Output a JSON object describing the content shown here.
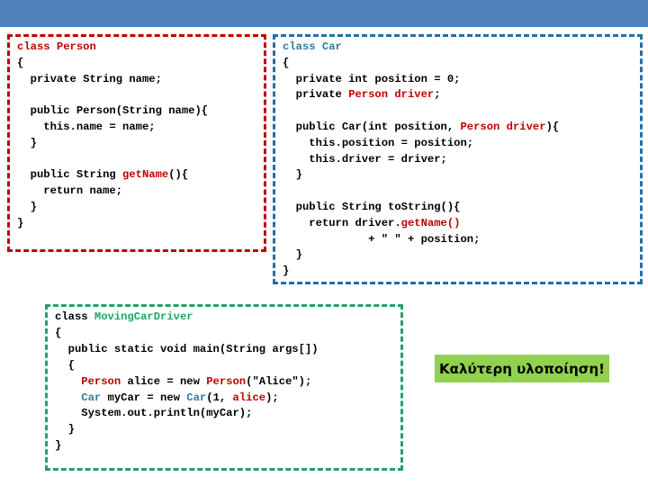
{
  "slide": {
    "top_bar_color": "#4f81bd",
    "background_color": "#ffffff"
  },
  "boxes": {
    "person": {
      "name": "Person class code block",
      "border_color": "#c00000",
      "lines": [
        [
          {
            "t": "class Person",
            "c": "red"
          }
        ],
        [
          {
            "t": "{",
            "c": "plain"
          }
        ],
        [
          {
            "t": "  private String name;",
            "c": "plain"
          }
        ],
        [
          {
            "t": "",
            "c": "plain"
          }
        ],
        [
          {
            "t": "  public Person(String name){",
            "c": "plain"
          }
        ],
        [
          {
            "t": "    this.name = name;",
            "c": "plain"
          }
        ],
        [
          {
            "t": "  }",
            "c": "plain"
          }
        ],
        [
          {
            "t": "",
            "c": "plain"
          }
        ],
        [
          {
            "t": "  public String ",
            "c": "plain"
          },
          {
            "t": "getName",
            "c": "red"
          },
          {
            "t": "(){",
            "c": "plain"
          }
        ],
        [
          {
            "t": "    return name;",
            "c": "plain"
          }
        ],
        [
          {
            "t": "  }",
            "c": "plain"
          }
        ],
        [
          {
            "t": "}",
            "c": "plain"
          }
        ]
      ]
    },
    "car": {
      "name": "Car class code block",
      "border_color": "#1f6fa8",
      "lines": [
        [
          {
            "t": "class Car",
            "c": "blue"
          }
        ],
        [
          {
            "t": "{",
            "c": "plain"
          }
        ],
        [
          {
            "t": "  private int position = 0;",
            "c": "plain"
          }
        ],
        [
          {
            "t": "  private ",
            "c": "plain"
          },
          {
            "t": "Person driver",
            "c": "red"
          },
          {
            "t": ";",
            "c": "plain"
          }
        ],
        [
          {
            "t": "",
            "c": "plain"
          }
        ],
        [
          {
            "t": "  public Car(int position, ",
            "c": "plain"
          },
          {
            "t": "Person driver",
            "c": "red"
          },
          {
            "t": "){",
            "c": "plain"
          }
        ],
        [
          {
            "t": "    this.position = position;",
            "c": "plain"
          }
        ],
        [
          {
            "t": "    this.driver = driver;",
            "c": "plain"
          }
        ],
        [
          {
            "t": "  }",
            "c": "plain"
          }
        ],
        [
          {
            "t": "",
            "c": "plain"
          }
        ],
        [
          {
            "t": "  public String toString(){",
            "c": "plain"
          }
        ],
        [
          {
            "t": "    return driver.",
            "c": "plain"
          },
          {
            "t": "getName()",
            "c": "red"
          }
        ],
        [
          {
            "t": "             + \" \" + position;",
            "c": "plain"
          }
        ],
        [
          {
            "t": "  }",
            "c": "plain"
          }
        ],
        [
          {
            "t": "}",
            "c": "plain"
          }
        ]
      ]
    },
    "driver": {
      "name": "MovingCarDriver class code block",
      "border_color": "#21a366",
      "lines": [
        [
          {
            "t": "class ",
            "c": "plain"
          },
          {
            "t": "MovingCarDriver",
            "c": "green"
          }
        ],
        [
          {
            "t": "{",
            "c": "plain"
          }
        ],
        [
          {
            "t": "  public static void main(String args[])",
            "c": "plain"
          }
        ],
        [
          {
            "t": "  {",
            "c": "plain"
          }
        ],
        [
          {
            "t": "    ",
            "c": "plain"
          },
          {
            "t": "Person",
            "c": "red"
          },
          {
            "t": " alice = new ",
            "c": "plain"
          },
          {
            "t": "Person",
            "c": "red"
          },
          {
            "t": "(\"Alice\");",
            "c": "plain"
          }
        ],
        [
          {
            "t": "    ",
            "c": "plain"
          },
          {
            "t": "Car",
            "c": "blue"
          },
          {
            "t": " myCar = new ",
            "c": "plain"
          },
          {
            "t": "Car",
            "c": "blue"
          },
          {
            "t": "(1, ",
            "c": "plain"
          },
          {
            "t": "alice",
            "c": "red"
          },
          {
            "t": ");",
            "c": "plain"
          }
        ],
        [
          {
            "t": "    System.out.println(myCar);",
            "c": "plain"
          }
        ],
        [
          {
            "t": "  }",
            "c": "plain"
          }
        ],
        [
          {
            "t": "}",
            "c": "plain"
          }
        ]
      ]
    }
  },
  "callout": {
    "text": "Καλύτερη υλοποίηση!",
    "background_color": "#92d050",
    "text_color": "#000000"
  }
}
